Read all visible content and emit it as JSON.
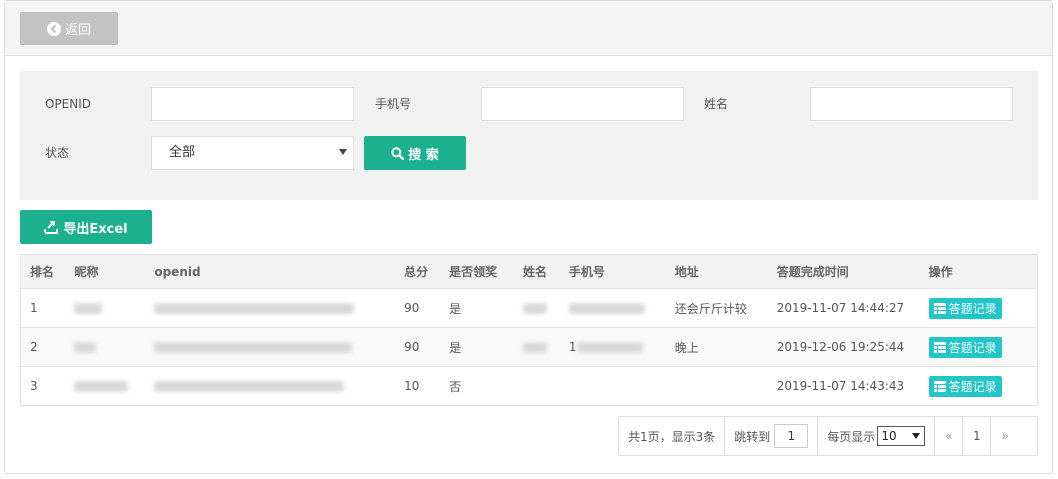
{
  "toolbar": {
    "back_label": "返回"
  },
  "filter": {
    "openid_label": "OPENID",
    "openid_value": "",
    "phone_label": "手机号",
    "phone_value": "",
    "name_label": "姓名",
    "name_value": "",
    "status_label": "状态",
    "status_selected": "全部",
    "search_label": "搜 索"
  },
  "export_label": "导出Excel",
  "table": {
    "headers": [
      "排名",
      "昵称",
      "openid",
      "总分",
      "是否领奖",
      "姓名",
      "手机号",
      "地址",
      "答题完成时间",
      "操作"
    ],
    "rows": [
      {
        "rank": "1",
        "score": "90",
        "awarded": "是",
        "address": "还会斤斤计较",
        "time": "2019-11-07 14:44:27",
        "phone_prefix": "",
        "action": "答题记录"
      },
      {
        "rank": "2",
        "score": "90",
        "awarded": "是",
        "address": "晚上",
        "time": "2019-12-06 19:25:44",
        "phone_prefix": "1",
        "action": "答题记录"
      },
      {
        "rank": "3",
        "score": "10",
        "awarded": "否",
        "address": "",
        "time": "2019-11-07 14:43:43",
        "phone_prefix": "",
        "action": "答题记录"
      }
    ]
  },
  "pager": {
    "summary": "共1页，显示3条",
    "jump_label": "跳转到",
    "jump_value": "1",
    "per_page_label": "每页显示",
    "per_page_value": "10",
    "prev": "«",
    "current_page": "1",
    "next": "»"
  },
  "colors": {
    "primary": "#1cb08f",
    "info": "#23c6c8",
    "back": "#c3c3c3"
  }
}
